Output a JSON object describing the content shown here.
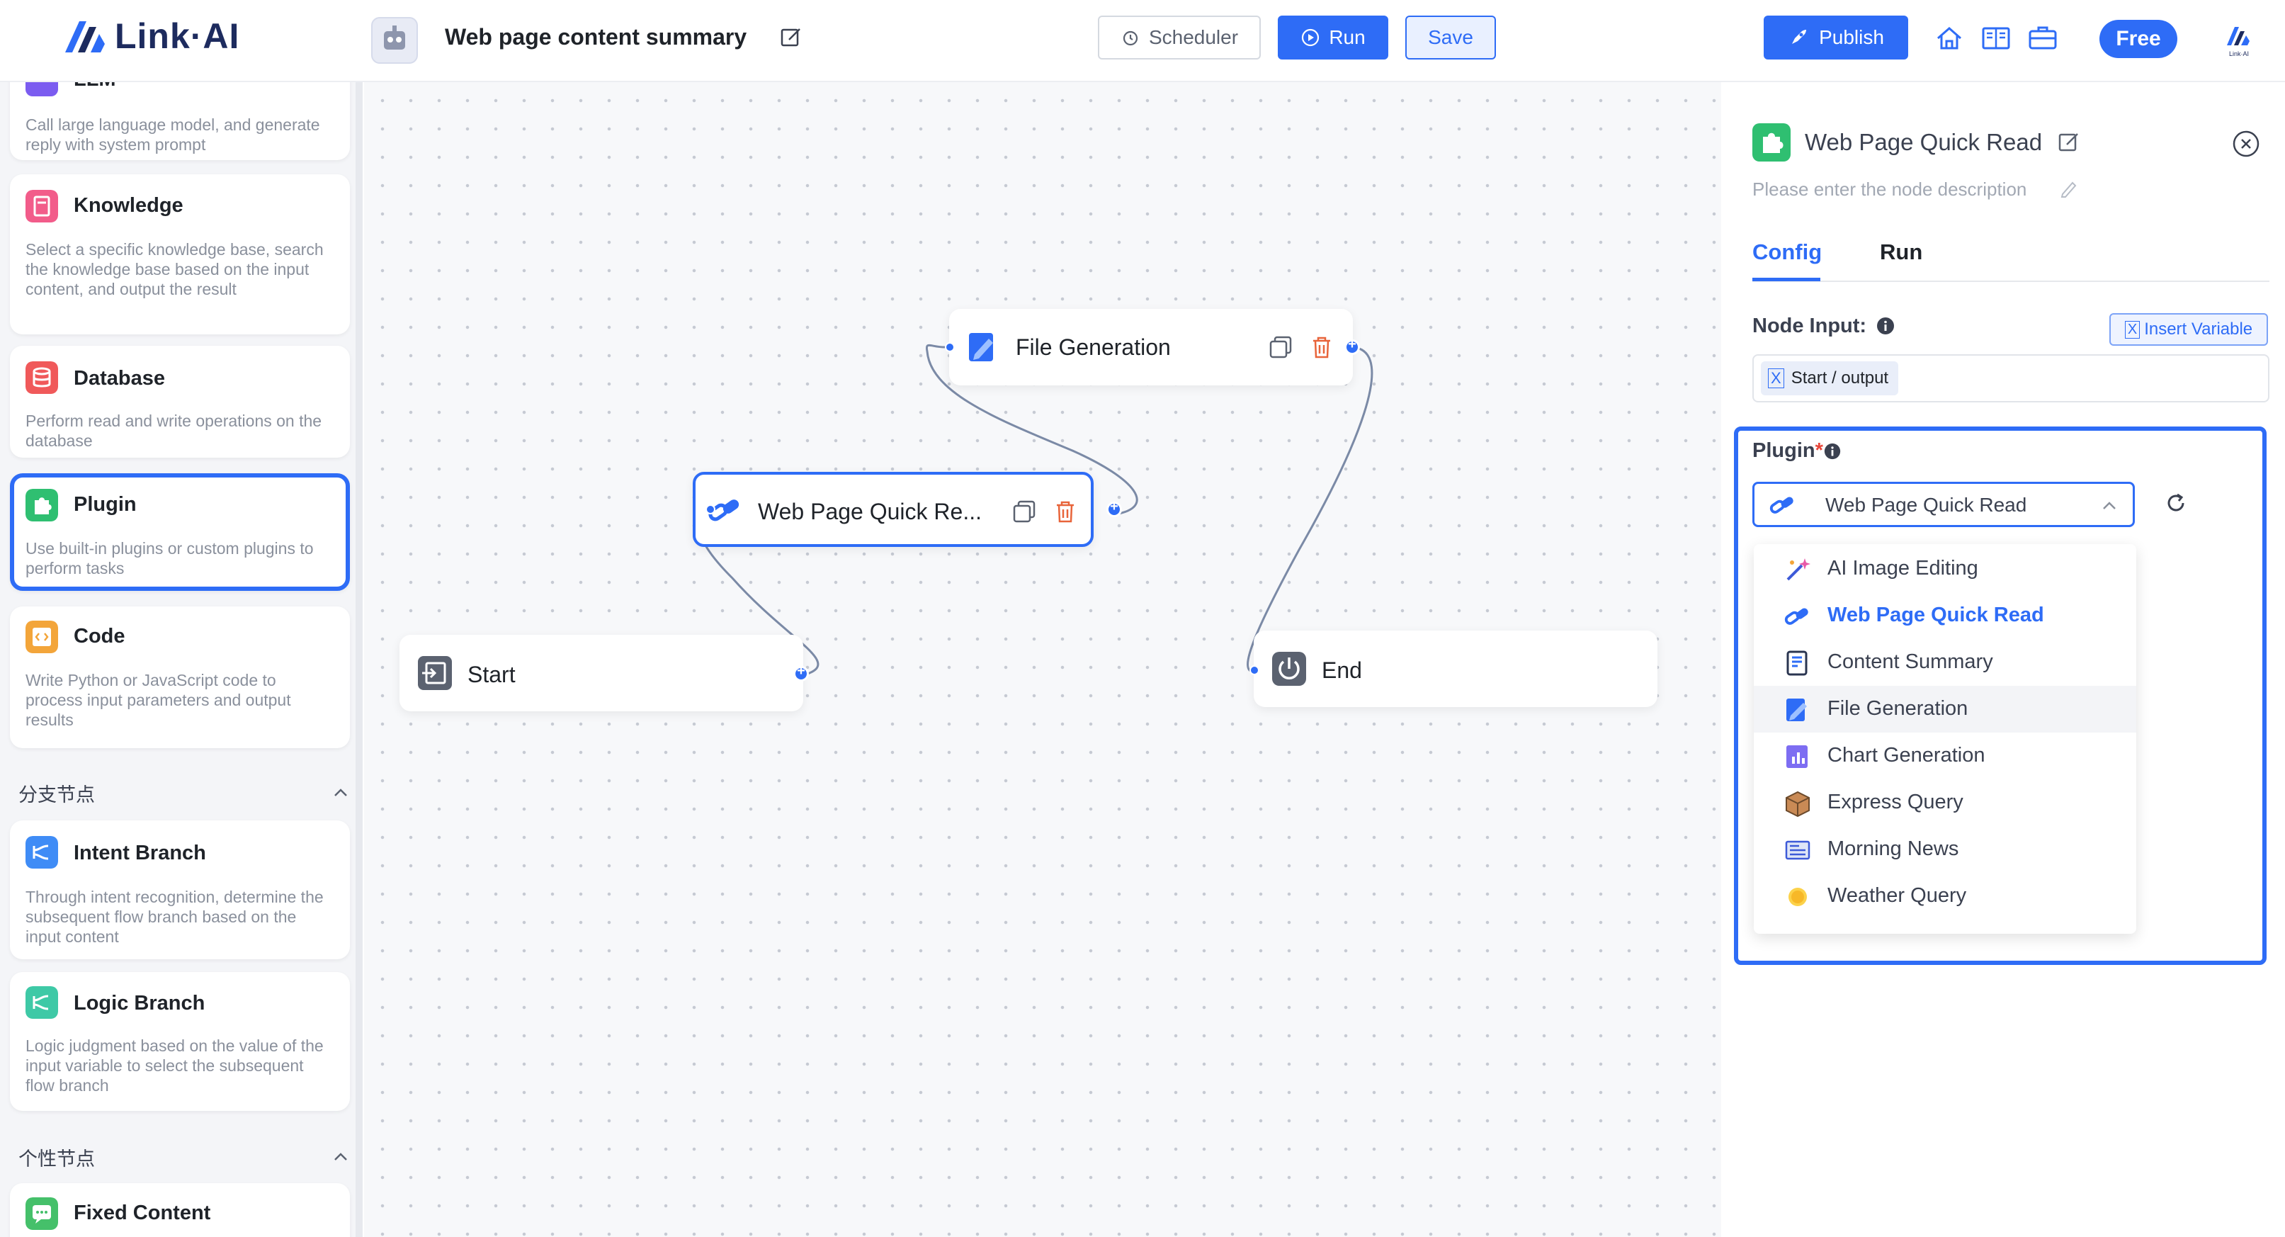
{
  "header": {
    "logo_text": "Link·AI",
    "app_title": "Web page content summary",
    "scheduler_label": "Scheduler",
    "run_label": "Run",
    "save_label": "Save",
    "publish_label": "Publish",
    "free_label": "Free",
    "mini_logo_text": "Link·AI"
  },
  "sidebar": {
    "cards": [
      {
        "title": "LLM",
        "desc": "Call large language model, and generate reply with system prompt"
      },
      {
        "title": "Knowledge",
        "desc": "Select a specific knowledge base, search the knowledge base based on the input content, and output the result"
      },
      {
        "title": "Database",
        "desc": "Perform read and write operations on the database"
      },
      {
        "title": "Plugin",
        "desc": "Use built-in plugins or custom plugins to perform tasks"
      },
      {
        "title": "Code",
        "desc": "Write Python or JavaScript code to process input parameters and output results"
      }
    ],
    "section_branch": "分支节点",
    "branch_cards": [
      {
        "title": "Intent Branch",
        "desc": "Through intent recognition, determine the subsequent flow branch based on the input content"
      },
      {
        "title": "Logic Branch",
        "desc": "Logic judgment based on the value of the input variable to select the subsequent flow branch"
      }
    ],
    "section_custom": "个性节点",
    "custom_cards": [
      {
        "title": "Fixed Content"
      }
    ]
  },
  "canvas": {
    "nodes": {
      "start": "Start",
      "web_quick_read": "Web Page Quick Re...",
      "file_generation": "File Generation",
      "end": "End"
    }
  },
  "panel": {
    "title": "Web Page Quick Read",
    "desc_placeholder": "Please enter the node description",
    "tabs": [
      "Config",
      "Run"
    ],
    "node_input_label": "Node Input:",
    "insert_variable": "Insert Variable",
    "var_chip": "Start / output",
    "plugin_label": "Plugin",
    "plugin_required": "*",
    "selected_plugin": "Web Page Quick Read",
    "options": [
      {
        "label": "AI Image Editing",
        "icon": "magic-wand-icon"
      },
      {
        "label": "Web Page Quick Read",
        "icon": "link-icon"
      },
      {
        "label": "Content Summary",
        "icon": "document-icon"
      },
      {
        "label": "File Generation",
        "icon": "file-generation-icon"
      },
      {
        "label": "Chart Generation",
        "icon": "chart-icon"
      },
      {
        "label": "Express Query",
        "icon": "package-icon"
      },
      {
        "label": "Morning News",
        "icon": "newspaper-icon"
      },
      {
        "label": "Weather Query",
        "icon": "sun-icon"
      }
    ]
  },
  "colors": {
    "accent": "#2e6cf6",
    "plugin_green": "#2fbf71",
    "delete_orange": "#e8643a"
  }
}
